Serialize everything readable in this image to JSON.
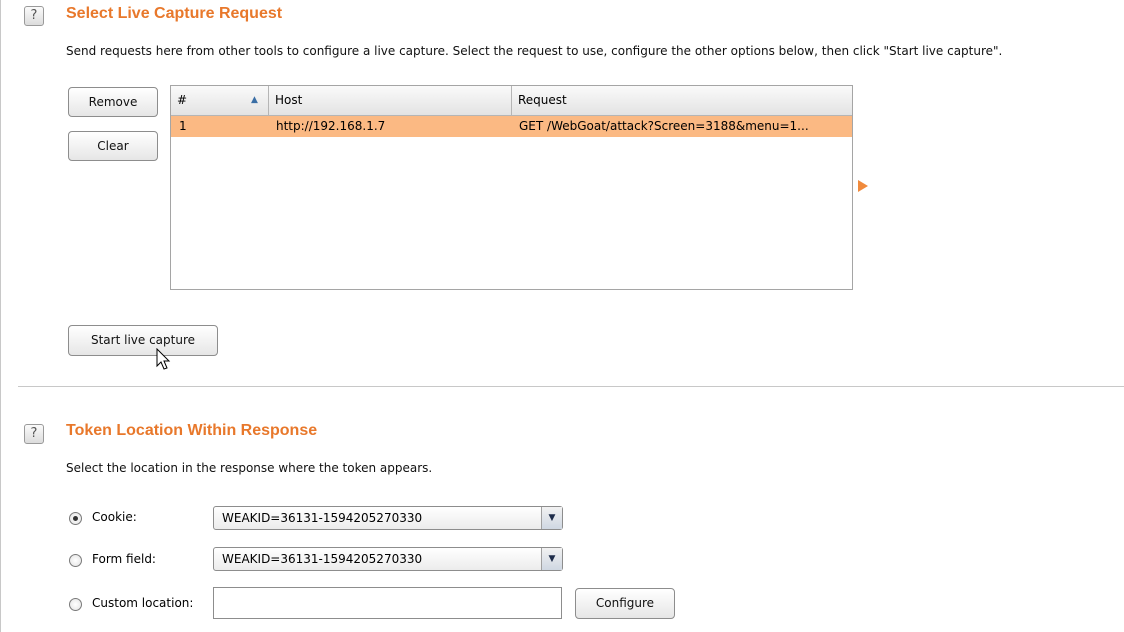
{
  "section1": {
    "help_icon": "?",
    "title": "Select Live Capture Request",
    "description": "Send requests here from other tools to configure a live capture. Select the request to use, configure the other options below, then click \"Start live capture\".",
    "remove_label": "Remove",
    "clear_label": "Clear",
    "table": {
      "columns": [
        "#",
        "Host",
        "Request"
      ],
      "sort_icon": "▲",
      "rows": [
        {
          "num": "1",
          "host": "http://192.168.1.7",
          "request": "GET /WebGoat/attack?Screen=3188&menu=1..."
        }
      ]
    },
    "expand_icon": "triangle-right-icon",
    "start_label": "Start live capture"
  },
  "section2": {
    "help_icon": "?",
    "title": "Token Location Within Response",
    "description": "Select the location in the response where the token appears.",
    "options": {
      "cookie": {
        "label": "Cookie:",
        "value": "WEAKID=36131-1594205270330",
        "checked": true
      },
      "form_field": {
        "label": "Form field:",
        "value": "WEAKID=36131-1594205270330",
        "checked": false
      },
      "custom": {
        "label": "Custom location:",
        "value": "",
        "checked": false
      }
    },
    "dropdown_icon": "▼",
    "configure_label": "Configure"
  },
  "colors": {
    "accent": "#e8782b",
    "selected_row": "#fbb983",
    "arrow": "#f08a3c"
  }
}
